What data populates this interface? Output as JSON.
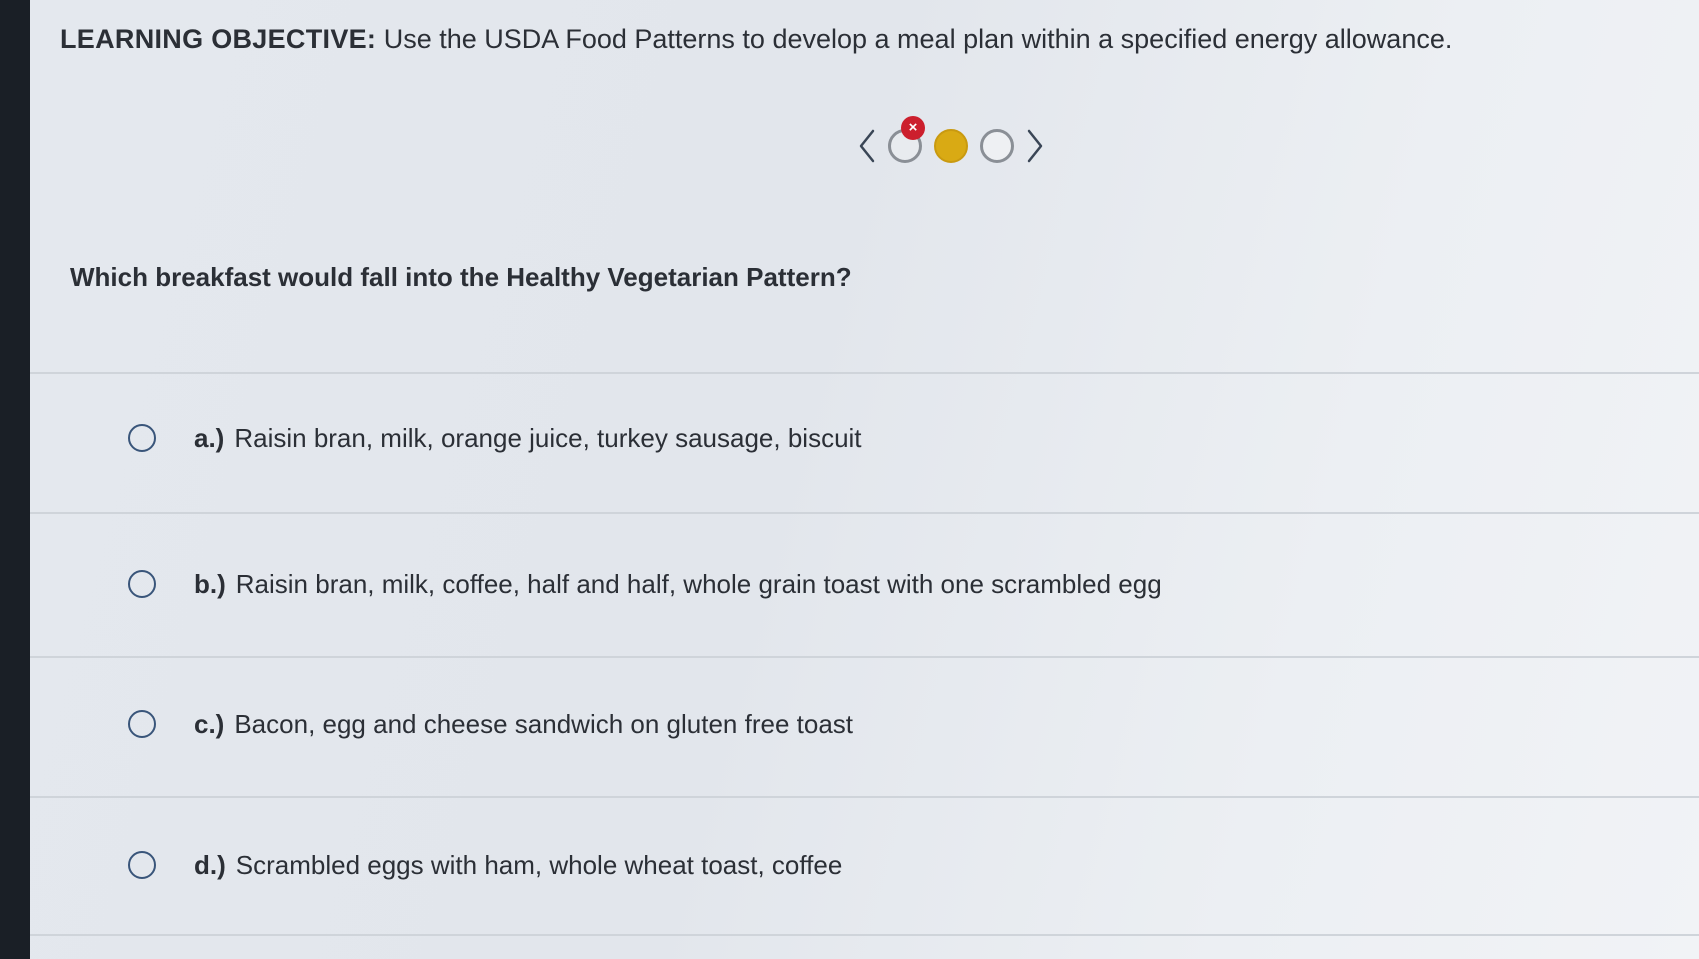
{
  "objective": {
    "label": "LEARNING OBJECTIVE:",
    "text": "Use the USDA Food Patterns to develop a meal plan within a specified energy allowance."
  },
  "pager": {
    "prev_icon": "chevron-left-icon",
    "next_icon": "chevron-right-icon",
    "wrong_mark": "×",
    "dots": [
      {
        "state": "incorrect"
      },
      {
        "state": "current"
      },
      {
        "state": "unanswered"
      }
    ]
  },
  "question": {
    "text": "Which breakfast would fall into the Healthy Vegetarian Pattern?"
  },
  "options": [
    {
      "letter": "a.)",
      "text": "Raisin bran, milk, orange juice, turkey sausage, biscuit"
    },
    {
      "letter": "b.)",
      "text": "Raisin bran, milk, coffee, half and half, whole grain toast with one scrambled egg"
    },
    {
      "letter": "c.)",
      "text": "Bacon, egg and cheese sandwich on gluten free toast"
    },
    {
      "letter": "d.)",
      "text": "Scrambled eggs with ham, whole wheat toast, coffee"
    }
  ],
  "colors": {
    "radio_border": "#39557a",
    "current_dot": "#d9aa14",
    "wrong_badge": "#cc1f2d",
    "text": "#2b2f36"
  }
}
